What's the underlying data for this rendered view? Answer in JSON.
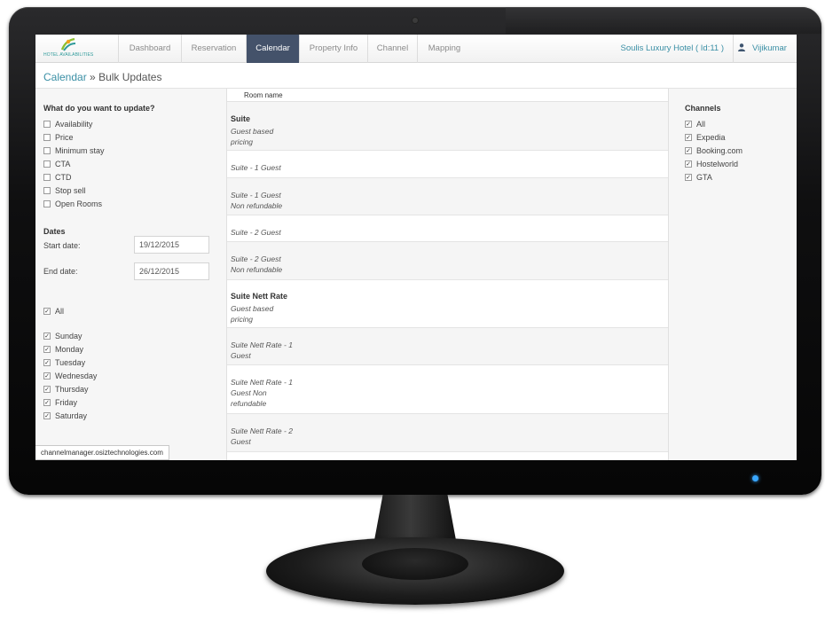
{
  "nav": {
    "logo_text": "HOTEL AVAILABILITIES",
    "items": [
      {
        "label": "Dashboard"
      },
      {
        "label": "Reservation"
      },
      {
        "label": "Calendar"
      },
      {
        "label": "Property Info"
      },
      {
        "label": "Channel"
      },
      {
        "label": "Mapping"
      }
    ],
    "active_index": 2,
    "hotel": "Soulis Luxury Hotel ( Id:11 )",
    "user": "Vijikumar"
  },
  "breadcrumb": {
    "link": "Calendar",
    "separator": "»",
    "current": "Bulk Updates"
  },
  "left": {
    "update_title": "What do you want to update?",
    "options": [
      {
        "label": "Availability",
        "checked": false
      },
      {
        "label": "Price",
        "checked": false
      },
      {
        "label": "Minimum stay",
        "checked": false
      },
      {
        "label": "CTA",
        "checked": false
      },
      {
        "label": "CTD",
        "checked": false
      },
      {
        "label": "Stop sell",
        "checked": false
      },
      {
        "label": "Open Rooms",
        "checked": false
      }
    ],
    "dates_title": "Dates",
    "start_label": "Start date:",
    "start_value": "19/12/2015",
    "end_label": "End date:",
    "end_value": "26/12/2015",
    "all_label": "All",
    "days": [
      {
        "label": "Sunday",
        "checked": true
      },
      {
        "label": "Monday",
        "checked": true
      },
      {
        "label": "Tuesday",
        "checked": true
      },
      {
        "label": "Wednesday",
        "checked": true
      },
      {
        "label": "Thursday",
        "checked": true
      },
      {
        "label": "Friday",
        "checked": true
      },
      {
        "label": "Saturday",
        "checked": true
      }
    ]
  },
  "rooms": {
    "header": "Room name",
    "rows": [
      {
        "title": "Suite",
        "sub": "Guest based\npricing"
      },
      {
        "title": "",
        "sub": "Suite - 1 Guest"
      },
      {
        "title": "",
        "sub": "Suite - 1 Guest\nNon refundable"
      },
      {
        "title": "",
        "sub": "Suite - 2 Guest"
      },
      {
        "title": "",
        "sub": "Suite - 2 Guest\nNon refundable"
      },
      {
        "title": "Suite Nett Rate",
        "sub": "Guest based\npricing"
      },
      {
        "title": "",
        "sub": "Suite Nett Rate - 1\nGuest"
      },
      {
        "title": "",
        "sub": "Suite Nett Rate - 1\nGuest Non\nrefundable"
      },
      {
        "title": "",
        "sub": "Suite Nett Rate - 2\nGuest"
      }
    ]
  },
  "channels": {
    "title": "Channels",
    "items": [
      {
        "label": "All",
        "checked": true
      },
      {
        "label": "Expedia",
        "checked": true
      },
      {
        "label": "Booking.com",
        "checked": true
      },
      {
        "label": "Hostelworld",
        "checked": true
      },
      {
        "label": "GTA",
        "checked": true
      }
    ]
  },
  "status_url": "channelmanager.osiztechnologies.com",
  "colors": {
    "active_nav": "#44526a",
    "link": "#3a8fa5",
    "power_led": "#39a7ff"
  }
}
